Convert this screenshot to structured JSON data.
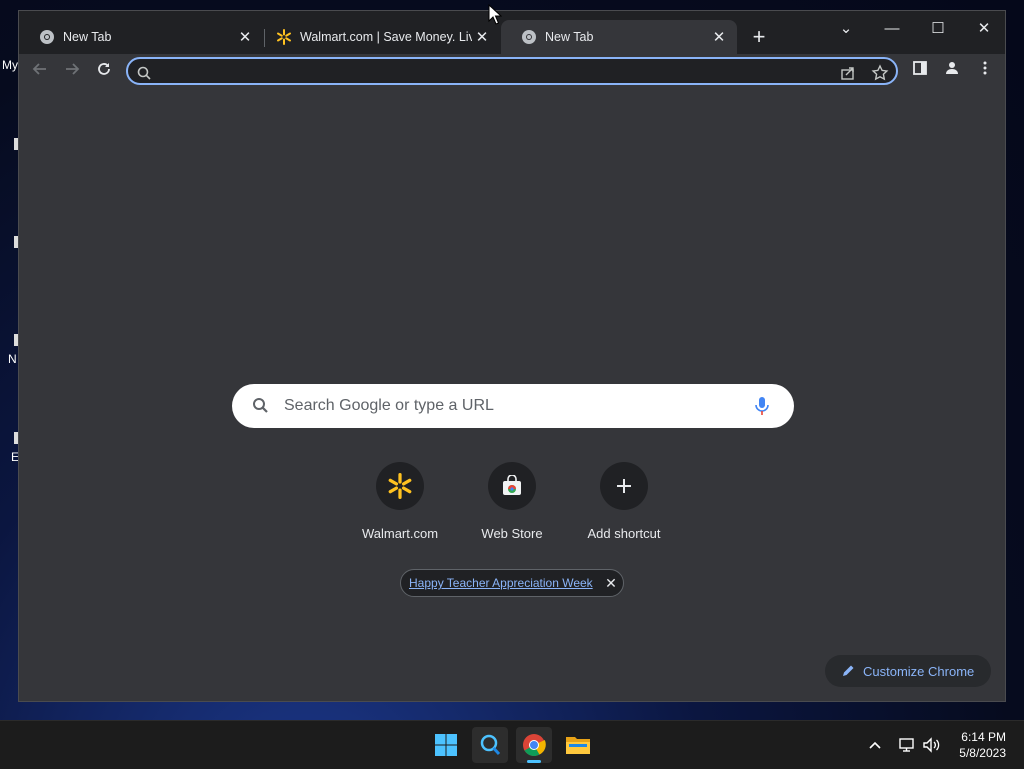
{
  "desktop": {
    "edge_label_top": "My",
    "edge_label_mid": "N",
    "edge_label_bottom": "E"
  },
  "tabs": [
    {
      "title": "New Tab",
      "icon": "chrome-icon",
      "active": false
    },
    {
      "title": "Walmart.com | Save Money. Live",
      "icon": "walmart-spark-icon",
      "active": false
    },
    {
      "title": "New Tab",
      "icon": "chrome-icon",
      "active": true
    }
  ],
  "toolbar": {
    "back_icon": "back-arrow-icon",
    "forward_icon": "forward-arrow-icon",
    "reload_icon": "reload-icon",
    "omnibox_value": "",
    "omnibox_placeholder": ""
  },
  "ntp": {
    "search_placeholder": "Search Google or type a URL",
    "shortcuts": [
      {
        "label": "Walmart.com",
        "icon": "walmart-spark-icon"
      },
      {
        "label": "Web Store",
        "icon": "web-store-icon"
      },
      {
        "label": "Add shortcut",
        "icon": "plus-icon"
      }
    ],
    "promo_text": "Happy Teacher Appreciation Week",
    "customize_label": "Customize Chrome"
  },
  "taskbar": {
    "time": "6:14 PM",
    "date": "5/8/2023",
    "apps": [
      "start",
      "search",
      "chrome",
      "file-explorer"
    ]
  },
  "colors": {
    "accent": "#8ab4f8",
    "walmart_yellow": "#ffc220",
    "tab_strip": "#202124",
    "toolbar": "#35363a"
  }
}
